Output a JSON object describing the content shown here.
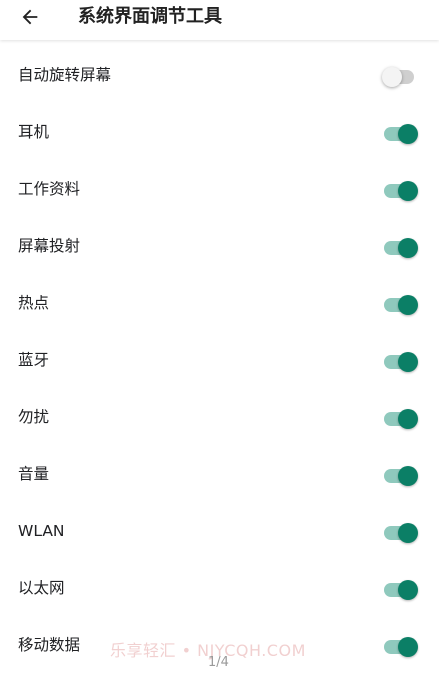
{
  "header": {
    "title": "系统界面调节工具",
    "back_icon": "arrow-back-icon"
  },
  "colors": {
    "switch_on_thumb": "#0b7f66",
    "switch_on_track": "#8fc9bd",
    "switch_off_thumb": "#f4f4f4",
    "switch_off_track": "#cfcfcf"
  },
  "items": [
    {
      "label": "自动旋转屏幕",
      "enabled": false
    },
    {
      "label": "耳机",
      "enabled": true
    },
    {
      "label": "工作资料",
      "enabled": true
    },
    {
      "label": "屏幕投射",
      "enabled": true
    },
    {
      "label": "热点",
      "enabled": true
    },
    {
      "label": "蓝牙",
      "enabled": true
    },
    {
      "label": "勿扰",
      "enabled": true
    },
    {
      "label": "音量",
      "enabled": true
    },
    {
      "label": "WLAN",
      "enabled": true
    },
    {
      "label": "以太网",
      "enabled": true
    },
    {
      "label": "移动数据",
      "enabled": true
    }
  ],
  "watermark": "乐享轻汇 • NJYCQH.COM",
  "page_indicator": "1/4"
}
